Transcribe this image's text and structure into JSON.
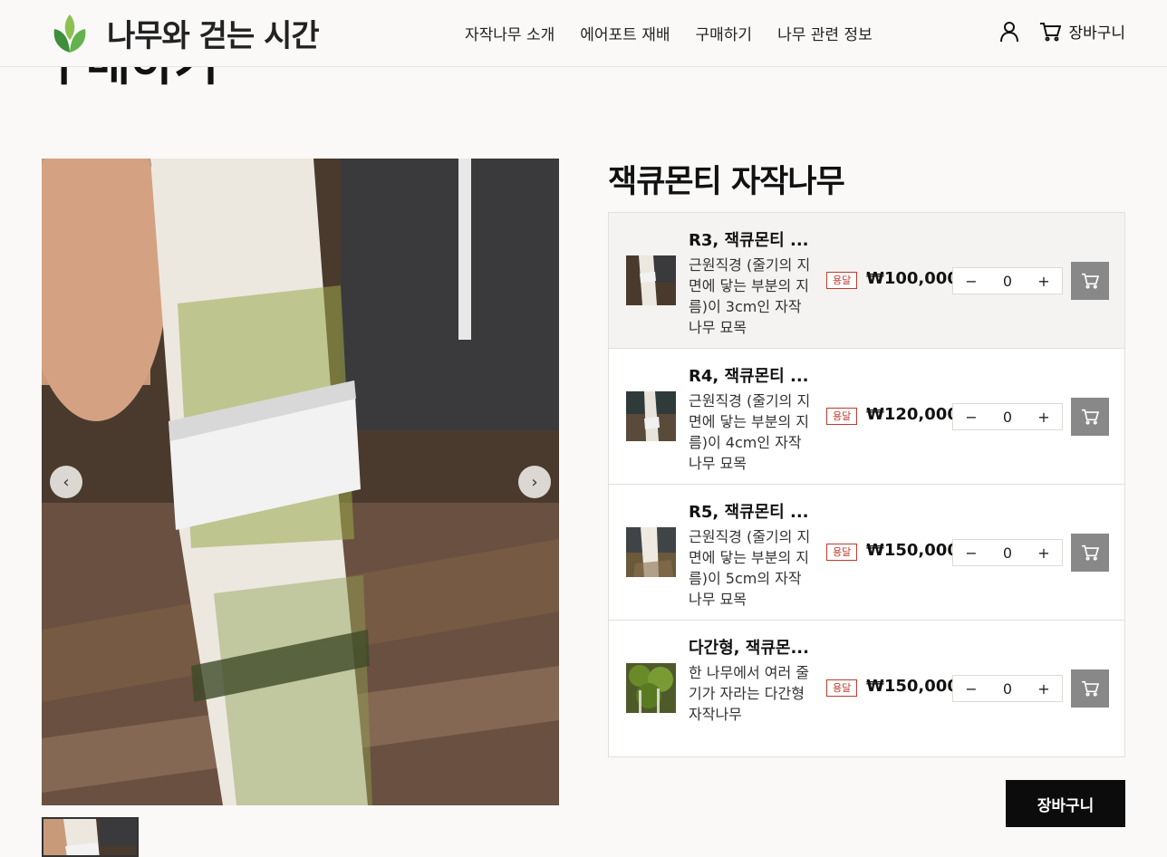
{
  "header": {
    "logo_text": "나무와 걷는 시간",
    "nav": [
      "자작나무 소개",
      "에어포트 재배",
      "구매하기",
      "나무 관련 정보"
    ],
    "cart_label": "장바구니"
  },
  "page": {
    "heading": "구매하기"
  },
  "product": {
    "title": "잭큐몬티 자작나무",
    "options": [
      {
        "name": "R3, 잭큐몬티 ...",
        "desc": "근원직경 (줄기의 지면에 닿는 부분의 지름)이 3cm인 자작나무 묘목",
        "badge": "용달",
        "price": "₩100,000",
        "qty": "0",
        "active": true
      },
      {
        "name": "R4, 잭큐몬티 ...",
        "desc": "근원직경 (줄기의 지면에 닿는 부분의 지름)이 4cm인 자작나무 묘목",
        "badge": "용달",
        "price": "₩120,000",
        "qty": "0",
        "active": false
      },
      {
        "name": "R5, 잭큐몬티 ...",
        "desc": "근원직경 (줄기의 지면에 닿는 부분의 지름)이 5cm의 자작나무 묘목",
        "badge": "용달",
        "price": "₩150,000",
        "qty": "0",
        "active": false
      },
      {
        "name": "다간형, 잭큐몬...",
        "desc": "한 나무에서 여러 줄기가 자라는 다간형 자작나무",
        "badge": "용달",
        "price": "₩150,000",
        "qty": "0",
        "active": false
      }
    ],
    "stepper": {
      "minus": "−",
      "plus": "+"
    },
    "cart_button_label": "장바구니"
  },
  "gallery": {
    "prev": "‹",
    "next": "›"
  },
  "colors": {
    "accent": "#0c0c0c",
    "badge": "#c0392b",
    "add_button": "#888888",
    "background": "#faf9f7"
  }
}
